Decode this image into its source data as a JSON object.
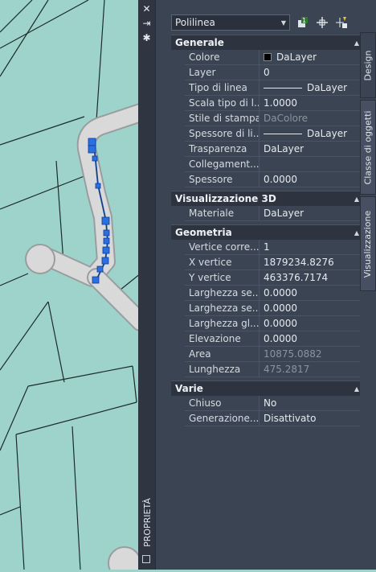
{
  "strip": {
    "close_glyph": "✕",
    "autohide_glyph": "⇥",
    "settings_glyph": "✱",
    "title": "PROPRIETÀ"
  },
  "toolbar": {
    "object_type": "Polilinea",
    "icons": [
      "toggle-pickadd-icon",
      "select-objects-icon",
      "quick-select-icon"
    ]
  },
  "sections": {
    "generale": {
      "title": "Generale",
      "rows": [
        {
          "label": "Colore",
          "value": "DaLayer"
        },
        {
          "label": "Layer",
          "value": "0"
        },
        {
          "label": "Tipo di linea",
          "value": "DaLayer"
        },
        {
          "label": "Scala tipo di l...",
          "value": "1.0000"
        },
        {
          "label": "Stile di stampa",
          "value": "DaColore"
        },
        {
          "label": "Spessore di li...",
          "value": "DaLayer"
        },
        {
          "label": "Trasparenza",
          "value": "DaLayer"
        },
        {
          "label": "Collegament...",
          "value": ""
        },
        {
          "label": "Spessore",
          "value": "0.0000"
        }
      ]
    },
    "vis3d": {
      "title": "Visualizzazione 3D",
      "rows": [
        {
          "label": "Materiale",
          "value": "DaLayer"
        }
      ]
    },
    "geometria": {
      "title": "Geometria",
      "rows": [
        {
          "label": "Vertice corre...",
          "value": "1"
        },
        {
          "label": "X vertice",
          "value": "1879234.8276"
        },
        {
          "label": "Y vertice",
          "value": "463376.7174"
        },
        {
          "label": "Larghezza se...",
          "value": "0.0000"
        },
        {
          "label": "Larghezza se...",
          "value": "0.0000"
        },
        {
          "label": "Larghezza gl...",
          "value": "0.0000"
        },
        {
          "label": "Elevazione",
          "value": "0.0000"
        },
        {
          "label": "Area",
          "value": "10875.0882"
        },
        {
          "label": "Lunghezza",
          "value": "475.2817"
        }
      ]
    },
    "varie": {
      "title": "Varie",
      "rows": [
        {
          "label": "Chiuso",
          "value": "No"
        },
        {
          "label": "Generazione...",
          "value": "Disattivato"
        }
      ]
    }
  },
  "tabs": [
    "Design",
    "Classe di oggetti",
    "Visualizzazione"
  ]
}
